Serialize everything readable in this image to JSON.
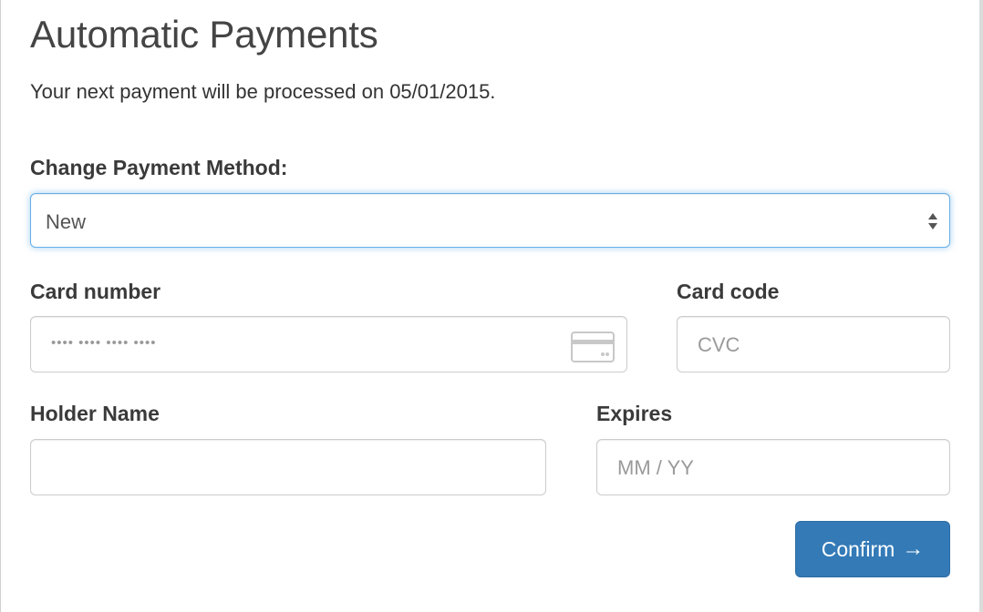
{
  "header": {
    "title": "Automatic Payments",
    "subtitle": "Your next payment will be processed on 05/01/2015."
  },
  "payment_method": {
    "label": "Change Payment Method:",
    "selected": "New"
  },
  "card_number": {
    "label": "Card number",
    "placeholder": "•••• •••• •••• ••••",
    "icon": "credit-card-icon"
  },
  "card_code": {
    "label": "Card code",
    "placeholder": "CVC"
  },
  "holder_name": {
    "label": "Holder Name",
    "value": ""
  },
  "expires": {
    "label": "Expires",
    "placeholder": "MM / YY"
  },
  "confirm": {
    "label": "Confirm",
    "arrow": "→"
  },
  "colors": {
    "primary": "#337ab7",
    "focus_border": "#66afe9",
    "text": "#333333",
    "placeholder": "#9a9a9a"
  }
}
